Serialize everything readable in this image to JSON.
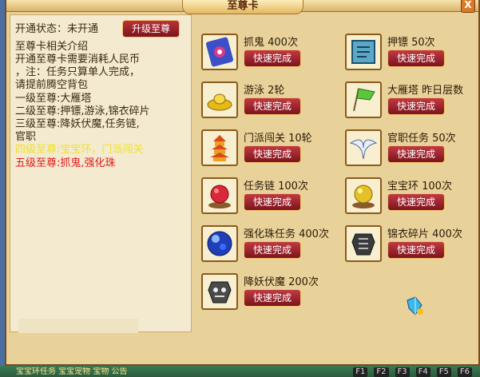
{
  "window": {
    "title": "至尊卡",
    "close_label": "X"
  },
  "status": {
    "text": "开通状态：未开通",
    "upgrade_label": "升级至尊"
  },
  "intro": {
    "title": "至尊卡相关介绍",
    "lines": [
      "开通至尊卡需要消耗人民币",
      "，注：任务只算单人完成，",
      "请提前腾空背包",
      "一级至尊:大雁塔",
      "二级至尊:押镖,游泳,锦衣碎片",
      "三级至尊:降妖伏魔,任务链,",
      "官职"
    ],
    "level4": "四级至尊:宝宝环，门派闯关",
    "level5": "五级至尊:抓鬼,强化珠"
  },
  "items": [
    {
      "label": "抓鬼  400次",
      "button": "快速完成",
      "icon": "ghost-scroll-icon"
    },
    {
      "label": "押镖  50次",
      "button": "快速完成",
      "icon": "book-icon"
    },
    {
      "label": "游泳  2轮",
      "button": "快速完成",
      "icon": "gold-ingot-icon"
    },
    {
      "label": "大雁塔  昨日层数",
      "button": "快速完成",
      "icon": "green-flag-icon"
    },
    {
      "label": "门派闯关  10轮",
      "button": "快速完成",
      "icon": "pagoda-icon"
    },
    {
      "label": "官职任务  50次",
      "button": "快速完成",
      "icon": "white-bird-icon"
    },
    {
      "label": "任务链  100次",
      "button": "快速完成",
      "icon": "red-orb-icon"
    },
    {
      "label": "宝宝环  100次",
      "button": "快速完成",
      "icon": "golden-orb-icon"
    },
    {
      "label": "强化珠任务  400次",
      "button": "快速完成",
      "icon": "blue-pearl-icon"
    },
    {
      "label": "锦衣碎片  400次",
      "button": "快速完成",
      "icon": "dark-armor-icon"
    },
    {
      "label": "降妖伏魔  200次",
      "button": "快速完成",
      "icon": "demon-mask-icon"
    }
  ],
  "bottom_bar": {
    "text": "宝宝环任务      宝宝宠物      宝物      公告",
    "slots": [
      "F1",
      "F2",
      "F3",
      "F4",
      "F5",
      "F6"
    ]
  }
}
